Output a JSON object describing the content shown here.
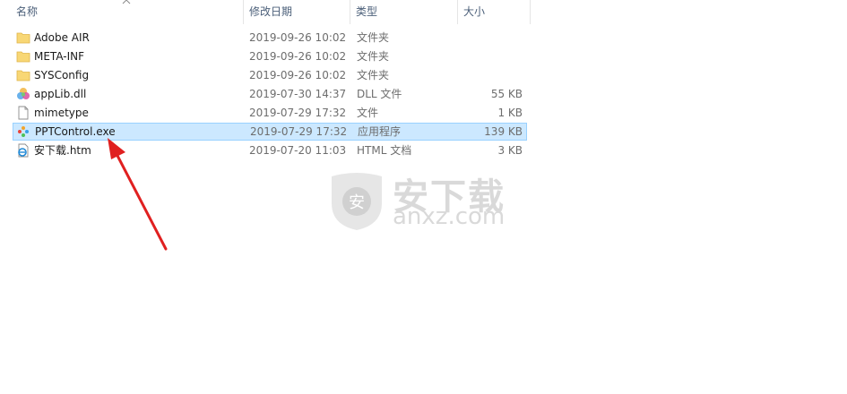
{
  "columns": {
    "name": "名称",
    "date": "修改日期",
    "type": "类型",
    "size": "大小"
  },
  "files": [
    {
      "name": "Adobe AIR",
      "date": "2019-09-26 10:02",
      "type": "文件夹",
      "size": "",
      "icon": "folder-icon"
    },
    {
      "name": "META-INF",
      "date": "2019-09-26 10:02",
      "type": "文件夹",
      "size": "",
      "icon": "folder-icon"
    },
    {
      "name": "SYSConfig",
      "date": "2019-09-26 10:02",
      "type": "文件夹",
      "size": "",
      "icon": "folder-icon"
    },
    {
      "name": "appLib.dll",
      "date": "2019-07-30 14:37",
      "type": "DLL 文件",
      "size": "55 KB",
      "icon": "dll-icon"
    },
    {
      "name": "mimetype",
      "date": "2019-07-29 17:32",
      "type": "文件",
      "size": "1 KB",
      "icon": "file-icon"
    },
    {
      "name": "PPTControl.exe",
      "date": "2019-07-29 17:32",
      "type": "应用程序",
      "size": "139 KB",
      "icon": "exe-icon",
      "selected": true
    },
    {
      "name": "安下载.htm",
      "date": "2019-07-20 11:03",
      "type": "HTML 文档",
      "size": "3 KB",
      "icon": "ie-html-icon"
    }
  ],
  "watermark": {
    "cn": "安下载",
    "en": "anxz.com",
    "badge": "安"
  },
  "colors": {
    "selected_bg": "#cce8ff",
    "selected_border": "#99d1ff",
    "folder": "#f8d775",
    "arrow": "#e02020"
  }
}
